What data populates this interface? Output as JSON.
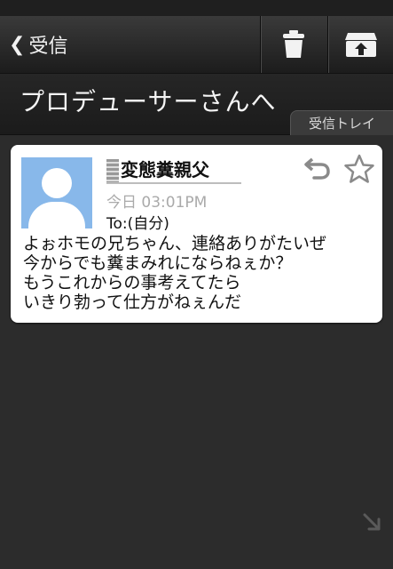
{
  "nav": {
    "back_label": "受信",
    "back_chevron": "❮",
    "trash_icon": "trash-icon",
    "archive_icon": "archive-box-icon"
  },
  "header": {
    "title": "プロデューサーさんへ",
    "folder_tab": "受信トレイ"
  },
  "message": {
    "sender": "変態糞親父",
    "date": "今日 03:01PM",
    "to": "To:(自分)",
    "body": "よぉホモの兄ちゃん、連絡ありがたいぜ\n今からでも糞まみれにならねぇか？\nもうこれからの事考えてたら\nいきり勃って仕方がねぇんだ"
  },
  "colors": {
    "background": "#2c2c2c",
    "card": "#ffffff",
    "avatar": "#88b8ea"
  }
}
